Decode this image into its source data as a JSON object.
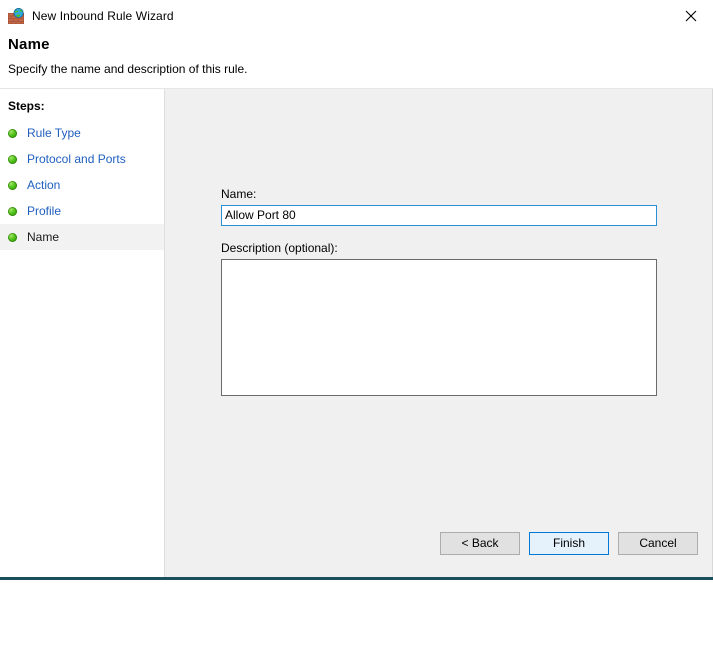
{
  "window": {
    "title": "New Inbound Rule Wizard",
    "icon": "firewall-globe-icon",
    "close_label": "✕",
    "accent_color": "#0078d7",
    "bottom_border_color": "#1b4f5e"
  },
  "header": {
    "title": "Name",
    "subtitle": "Specify the name and description of this rule."
  },
  "sidebar": {
    "heading": "Steps:",
    "items": [
      {
        "label": "Rule Type",
        "state": "completed",
        "bullet": "green-dot-icon"
      },
      {
        "label": "Protocol and Ports",
        "state": "completed",
        "bullet": "green-dot-icon"
      },
      {
        "label": "Action",
        "state": "completed",
        "bullet": "green-dot-icon"
      },
      {
        "label": "Profile",
        "state": "completed",
        "bullet": "green-dot-icon"
      },
      {
        "label": "Name",
        "state": "current",
        "bullet": "green-dot-icon"
      }
    ]
  },
  "form": {
    "name_label": "Name:",
    "name_value": "Allow Port 80",
    "name_placeholder": "",
    "description_label": "Description (optional):",
    "description_value": "",
    "description_placeholder": ""
  },
  "footer": {
    "back_label": "< Back",
    "finish_label": "Finish",
    "cancel_label": "Cancel",
    "hovered_button": "Finish"
  }
}
